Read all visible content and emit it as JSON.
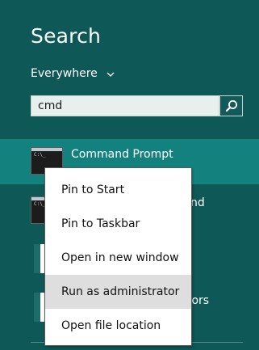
{
  "search": {
    "title": "Search",
    "scope_label": "Everywhere",
    "query": "cmd"
  },
  "results": [
    {
      "label": "Command Prompt",
      "icon": "command-prompt-icon",
      "selected": true
    },
    {
      "label": "",
      "partial_label": "nd",
      "icon": "command-prompt-icon"
    },
    {
      "label": "",
      "icon": "document-icon"
    },
    {
      "label": "",
      "partial_label": "tors",
      "icon": "document-icon"
    }
  ],
  "context_menu": {
    "items": [
      {
        "label": "Pin to Start"
      },
      {
        "label": "Pin to Taskbar"
      },
      {
        "label": "Open in new window"
      },
      {
        "label": "Run as administrator",
        "highlighted": true
      },
      {
        "label": "Open file location"
      }
    ]
  },
  "colors": {
    "background": "#0e5857",
    "selected_row": "#13827f",
    "menu_background": "#ffffff",
    "menu_highlight": "#dedede"
  }
}
